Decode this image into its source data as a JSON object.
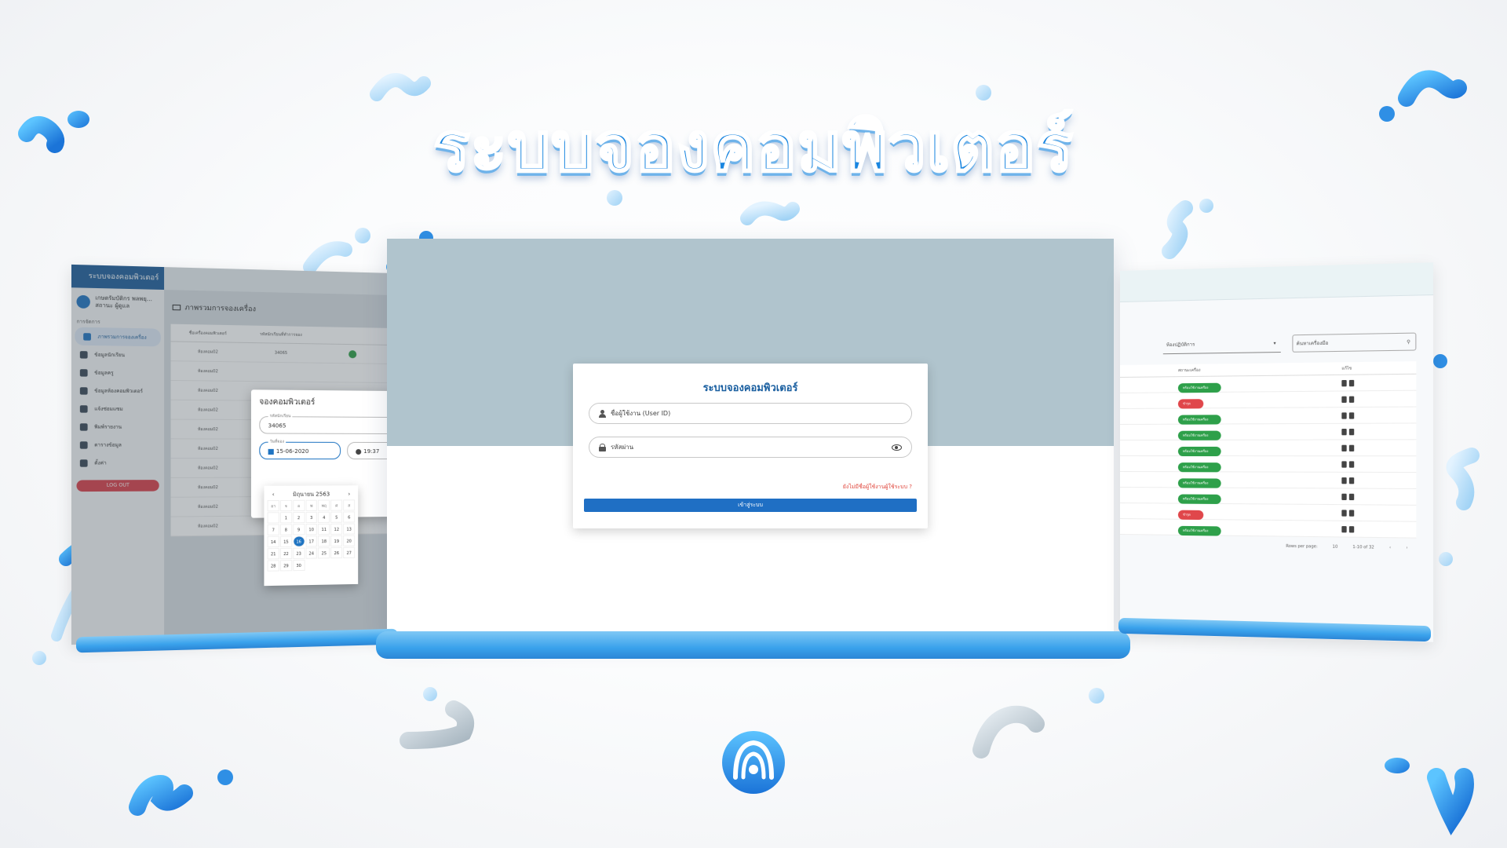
{
  "headline": "ระบบจองคอมพิวเตอร์",
  "colors": {
    "accent": "#1f6fc4",
    "brand": "#1a86e0",
    "danger": "#e0483e",
    "success": "#2ea04a"
  },
  "left_panel": {
    "brand": "ระบบจองคอมพิวเตอร์",
    "user_name": "เกษตรัมบัติกร พลพยุ...",
    "user_role": "สถานะ ผู้ดูแล",
    "section": "การจัดการ",
    "menu": [
      {
        "label": "ภาพรวมการจองเครื่อง",
        "icon": "monitor-icon"
      },
      {
        "label": "ข้อมูลนักเรียน",
        "icon": "student-icon"
      },
      {
        "label": "ข้อมูลครู",
        "icon": "teacher-icon"
      },
      {
        "label": "ข้อมูลห้องคอมพิวเตอร์",
        "icon": "database-icon"
      },
      {
        "label": "แจ้งซ่อมแซม",
        "icon": "wrench-icon"
      },
      {
        "label": "พิมพ์รายงาน",
        "icon": "printer-icon"
      },
      {
        "label": "ตารางข้อมูล",
        "icon": "save-icon"
      },
      {
        "label": "ตั้งค่า",
        "icon": "gear-icon"
      }
    ],
    "logout": "LOG OUT",
    "page_title": "ภาพรวมการจองเครื่อง",
    "table_headers": [
      "ชื่อเครื่องคอมพิวเตอร์",
      "รหัสนักเรียนที่ทำการจอง"
    ],
    "rows": [
      [
        "ห้องคอม02",
        "34065"
      ],
      [
        "ห้องคอม02",
        ""
      ],
      [
        "ห้องคอม02",
        ""
      ],
      [
        "ห้องคอม02",
        ""
      ],
      [
        "ห้องคอม02",
        ""
      ],
      [
        "ห้องคอม02",
        ""
      ],
      [
        "ห้องคอม02",
        ""
      ],
      [
        "ห้องคอม02",
        ""
      ],
      [
        "ห้องคอม02",
        ""
      ],
      [
        "ห้องคอม02",
        ""
      ]
    ],
    "dialog": {
      "title": "จองคอมพิวเตอร์",
      "student_label": "รหัสนักเรียน",
      "student_value": "34065",
      "date_label": "วันที่จอง",
      "date_value": "15-06-2020",
      "time_value": "19:37"
    },
    "calendar": {
      "month": "มิถุนายน 2563",
      "days_of_week": [
        "อา",
        "จ",
        "อ",
        "พ",
        "พฤ",
        "ศ",
        "ส"
      ],
      "days": [
        "",
        "1",
        "2",
        "3",
        "4",
        "5",
        "6",
        "7",
        "8",
        "9",
        "10",
        "11",
        "12",
        "13",
        "14",
        "15",
        "16",
        "17",
        "18",
        "19",
        "20",
        "21",
        "22",
        "23",
        "24",
        "25",
        "26",
        "27",
        "28",
        "29",
        "30"
      ],
      "selected": "16"
    }
  },
  "login": {
    "title": "ระบบจองคอมพิวเตอร์",
    "username_placeholder": "ชื่อผู้ใช้งาน (User ID)",
    "password_placeholder": "รหัสผ่าน",
    "forgot": "ยังไม่มีชื่อผู้ใช้งานผู้ใช้ระบบ ?",
    "submit": "เข้าสู่ระบบ"
  },
  "right_panel": {
    "select_label": "ห้องปฏิบัติการ",
    "search_placeholder": "ค้นหาเครื่องมือ",
    "col_status": "สถานะเครื่อง",
    "col_actions": "แก้ไข",
    "rows": [
      {
        "status": "พร้อมใช้งานเครื่อง",
        "kind": "green"
      },
      {
        "status": "ชำรุด",
        "kind": "red"
      },
      {
        "status": "พร้อมใช้งานเครื่อง",
        "kind": "green"
      },
      {
        "status": "พร้อมใช้งานเครื่อง",
        "kind": "green"
      },
      {
        "status": "พร้อมใช้งานเครื่อง",
        "kind": "green"
      },
      {
        "status": "พร้อมใช้งานเครื่อง",
        "kind": "green"
      },
      {
        "status": "พร้อมใช้งานเครื่อง",
        "kind": "green"
      },
      {
        "status": "พร้อมใช้งานเครื่อง",
        "kind": "green"
      },
      {
        "status": "ชำรุด",
        "kind": "red"
      },
      {
        "status": "พร้อมใช้งานเครื่อง",
        "kind": "green"
      }
    ],
    "pager": {
      "rows_per_page": "Rows per page:",
      "page_size": "10",
      "range": "1-10 of 32"
    }
  }
}
